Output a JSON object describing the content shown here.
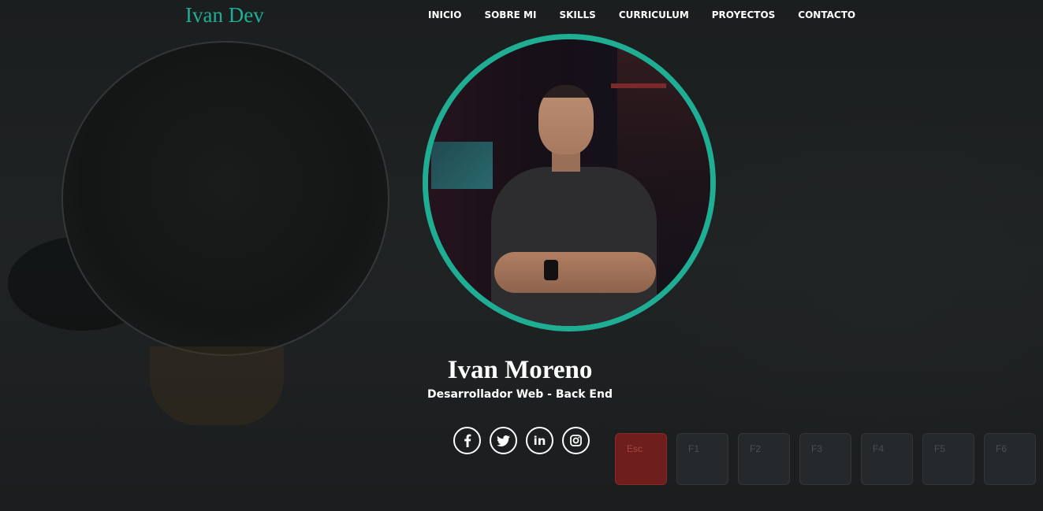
{
  "header": {
    "brand": "Ivan Dev",
    "nav": [
      "INICIO",
      "SOBRE MI",
      "SKILLS",
      "CURRICULUM",
      "PROYECTOS",
      "CONTACTO"
    ]
  },
  "hero": {
    "name": "Ivan Moreno",
    "role": "Desarrollador Web - Back End"
  },
  "social": [
    {
      "icon": "facebook-icon"
    },
    {
      "icon": "twitter-icon"
    },
    {
      "icon": "linkedin-icon",
      "glyph": "in"
    },
    {
      "icon": "instagram-icon"
    }
  ],
  "keyboard_keys": [
    "Esc",
    "F1",
    "F2",
    "F3",
    "F4",
    "F5",
    "F6"
  ],
  "colors": {
    "accent": "#1fae93",
    "background": "#1c1f20",
    "text": "#ffffff"
  }
}
